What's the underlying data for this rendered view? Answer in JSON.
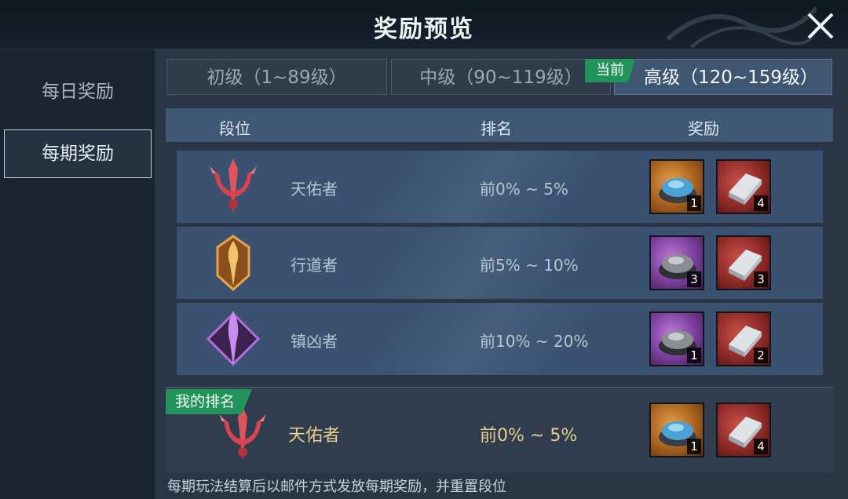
{
  "header": {
    "title": "奖励预览",
    "close_icon": "close-icon"
  },
  "sidebar": {
    "items": [
      {
        "label": "每日奖励",
        "active": false
      },
      {
        "label": "每期奖励",
        "active": true
      }
    ]
  },
  "tabs": [
    {
      "label": "初级（1~89级）",
      "active": false
    },
    {
      "label": "中级（90~119级）",
      "active": false
    },
    {
      "label": "高级（120~159级）",
      "active": true
    }
  ],
  "current_badge": "当前",
  "table": {
    "headers": [
      "段位",
      "排名",
      "奖励"
    ],
    "rows": [
      {
        "tier": "天佑者",
        "rank_range": "前0% ~ 5%",
        "emblem": "trident-emblem-icon",
        "rewards": [
          {
            "icon": "blue-powder-bowl-icon",
            "count": "1",
            "frame": "gold"
          },
          {
            "icon": "silver-ingot-icon",
            "count": "4",
            "frame": "red"
          }
        ]
      },
      {
        "tier": "行道者",
        "rank_range": "前5% ~ 10%",
        "emblem": "golden-sword-emblem-icon",
        "rewards": [
          {
            "icon": "gray-powder-bowl-icon",
            "count": "3",
            "frame": "purple"
          },
          {
            "icon": "silver-ingot-icon",
            "count": "3",
            "frame": "red"
          }
        ]
      },
      {
        "tier": "镇凶者",
        "rank_range": "前10% ~ 20%",
        "emblem": "purple-blade-emblem-icon",
        "rewards": [
          {
            "icon": "gray-powder-bowl-icon",
            "count": "1",
            "frame": "purple"
          },
          {
            "icon": "silver-ingot-icon",
            "count": "2",
            "frame": "red"
          }
        ]
      }
    ]
  },
  "my_rank": {
    "badge": "我的排名",
    "tier": "天佑者",
    "rank_range": "前0% ~ 5%",
    "rewards": [
      {
        "icon": "blue-powder-bowl-icon",
        "count": "1",
        "frame": "gold"
      },
      {
        "icon": "silver-ingot-icon",
        "count": "4",
        "frame": "red"
      }
    ]
  },
  "footer_note": "每期玩法结算后以邮件方式发放每期奖励，并重置段位",
  "colors": {
    "accent_green": "#22935a",
    "active_tab": "#3e5670",
    "my_rank_text": "#e9cf8d"
  }
}
